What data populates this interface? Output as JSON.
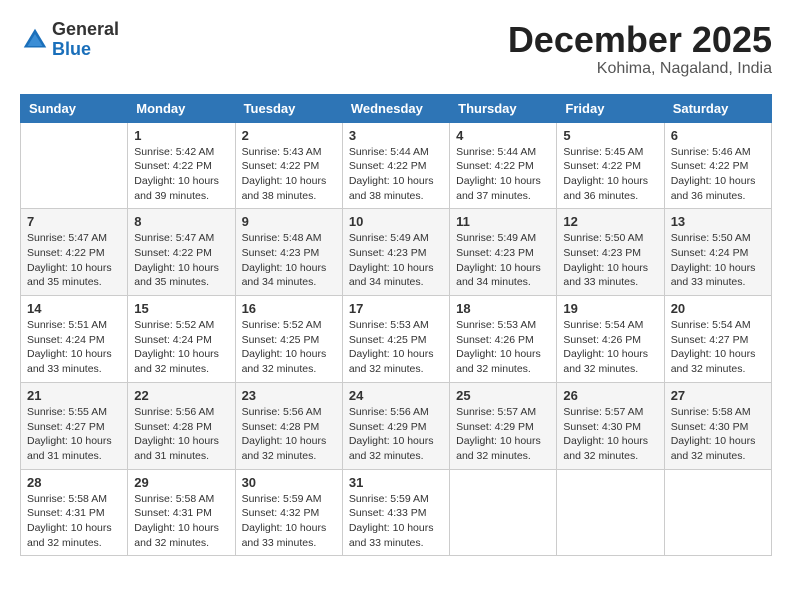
{
  "header": {
    "logo_general": "General",
    "logo_blue": "Blue",
    "month_title": "December 2025",
    "subtitle": "Kohima, Nagaland, India"
  },
  "days_of_week": [
    "Sunday",
    "Monday",
    "Tuesday",
    "Wednesday",
    "Thursday",
    "Friday",
    "Saturday"
  ],
  "weeks": [
    [
      {
        "day": "",
        "info": ""
      },
      {
        "day": "1",
        "info": "Sunrise: 5:42 AM\nSunset: 4:22 PM\nDaylight: 10 hours\nand 39 minutes."
      },
      {
        "day": "2",
        "info": "Sunrise: 5:43 AM\nSunset: 4:22 PM\nDaylight: 10 hours\nand 38 minutes."
      },
      {
        "day": "3",
        "info": "Sunrise: 5:44 AM\nSunset: 4:22 PM\nDaylight: 10 hours\nand 38 minutes."
      },
      {
        "day": "4",
        "info": "Sunrise: 5:44 AM\nSunset: 4:22 PM\nDaylight: 10 hours\nand 37 minutes."
      },
      {
        "day": "5",
        "info": "Sunrise: 5:45 AM\nSunset: 4:22 PM\nDaylight: 10 hours\nand 36 minutes."
      },
      {
        "day": "6",
        "info": "Sunrise: 5:46 AM\nSunset: 4:22 PM\nDaylight: 10 hours\nand 36 minutes."
      }
    ],
    [
      {
        "day": "7",
        "info": "Sunrise: 5:47 AM\nSunset: 4:22 PM\nDaylight: 10 hours\nand 35 minutes."
      },
      {
        "day": "8",
        "info": "Sunrise: 5:47 AM\nSunset: 4:22 PM\nDaylight: 10 hours\nand 35 minutes."
      },
      {
        "day": "9",
        "info": "Sunrise: 5:48 AM\nSunset: 4:23 PM\nDaylight: 10 hours\nand 34 minutes."
      },
      {
        "day": "10",
        "info": "Sunrise: 5:49 AM\nSunset: 4:23 PM\nDaylight: 10 hours\nand 34 minutes."
      },
      {
        "day": "11",
        "info": "Sunrise: 5:49 AM\nSunset: 4:23 PM\nDaylight: 10 hours\nand 34 minutes."
      },
      {
        "day": "12",
        "info": "Sunrise: 5:50 AM\nSunset: 4:23 PM\nDaylight: 10 hours\nand 33 minutes."
      },
      {
        "day": "13",
        "info": "Sunrise: 5:50 AM\nSunset: 4:24 PM\nDaylight: 10 hours\nand 33 minutes."
      }
    ],
    [
      {
        "day": "14",
        "info": "Sunrise: 5:51 AM\nSunset: 4:24 PM\nDaylight: 10 hours\nand 33 minutes."
      },
      {
        "day": "15",
        "info": "Sunrise: 5:52 AM\nSunset: 4:24 PM\nDaylight: 10 hours\nand 32 minutes."
      },
      {
        "day": "16",
        "info": "Sunrise: 5:52 AM\nSunset: 4:25 PM\nDaylight: 10 hours\nand 32 minutes."
      },
      {
        "day": "17",
        "info": "Sunrise: 5:53 AM\nSunset: 4:25 PM\nDaylight: 10 hours\nand 32 minutes."
      },
      {
        "day": "18",
        "info": "Sunrise: 5:53 AM\nSunset: 4:26 PM\nDaylight: 10 hours\nand 32 minutes."
      },
      {
        "day": "19",
        "info": "Sunrise: 5:54 AM\nSunset: 4:26 PM\nDaylight: 10 hours\nand 32 minutes."
      },
      {
        "day": "20",
        "info": "Sunrise: 5:54 AM\nSunset: 4:27 PM\nDaylight: 10 hours\nand 32 minutes."
      }
    ],
    [
      {
        "day": "21",
        "info": "Sunrise: 5:55 AM\nSunset: 4:27 PM\nDaylight: 10 hours\nand 31 minutes."
      },
      {
        "day": "22",
        "info": "Sunrise: 5:56 AM\nSunset: 4:28 PM\nDaylight: 10 hours\nand 31 minutes."
      },
      {
        "day": "23",
        "info": "Sunrise: 5:56 AM\nSunset: 4:28 PM\nDaylight: 10 hours\nand 32 minutes."
      },
      {
        "day": "24",
        "info": "Sunrise: 5:56 AM\nSunset: 4:29 PM\nDaylight: 10 hours\nand 32 minutes."
      },
      {
        "day": "25",
        "info": "Sunrise: 5:57 AM\nSunset: 4:29 PM\nDaylight: 10 hours\nand 32 minutes."
      },
      {
        "day": "26",
        "info": "Sunrise: 5:57 AM\nSunset: 4:30 PM\nDaylight: 10 hours\nand 32 minutes."
      },
      {
        "day": "27",
        "info": "Sunrise: 5:58 AM\nSunset: 4:30 PM\nDaylight: 10 hours\nand 32 minutes."
      }
    ],
    [
      {
        "day": "28",
        "info": "Sunrise: 5:58 AM\nSunset: 4:31 PM\nDaylight: 10 hours\nand 32 minutes."
      },
      {
        "day": "29",
        "info": "Sunrise: 5:58 AM\nSunset: 4:31 PM\nDaylight: 10 hours\nand 32 minutes."
      },
      {
        "day": "30",
        "info": "Sunrise: 5:59 AM\nSunset: 4:32 PM\nDaylight: 10 hours\nand 33 minutes."
      },
      {
        "day": "31",
        "info": "Sunrise: 5:59 AM\nSunset: 4:33 PM\nDaylight: 10 hours\nand 33 minutes."
      },
      {
        "day": "",
        "info": ""
      },
      {
        "day": "",
        "info": ""
      },
      {
        "day": "",
        "info": ""
      }
    ]
  ]
}
